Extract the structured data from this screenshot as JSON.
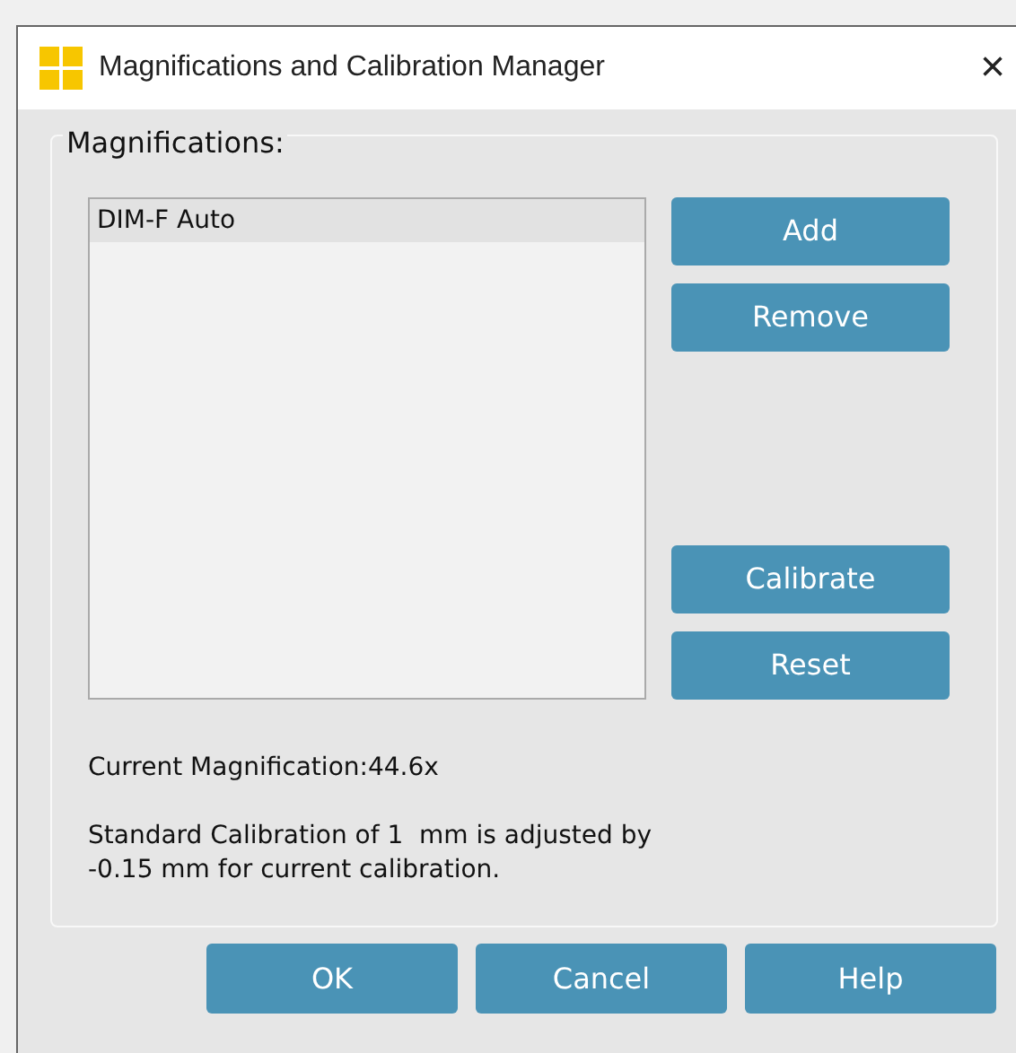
{
  "window": {
    "title": "Magnifications and Calibration Manager",
    "close": "×"
  },
  "magnifications": {
    "label": "Magnifications:",
    "items": [
      {
        "label": "DIM-F Auto",
        "selected": true
      }
    ],
    "upper_buttons": [
      "Add",
      "Remove"
    ],
    "lower_buttons": [
      "Calibrate",
      "Reset"
    ],
    "current": "Current Magnification:44.6x",
    "calibration_lines": [
      "Standard Calibration of 1  mm is adjusted by",
      "-0.15 mm for current calibration."
    ]
  },
  "buttons": [
    "OK",
    "Cancel",
    "Help"
  ]
}
